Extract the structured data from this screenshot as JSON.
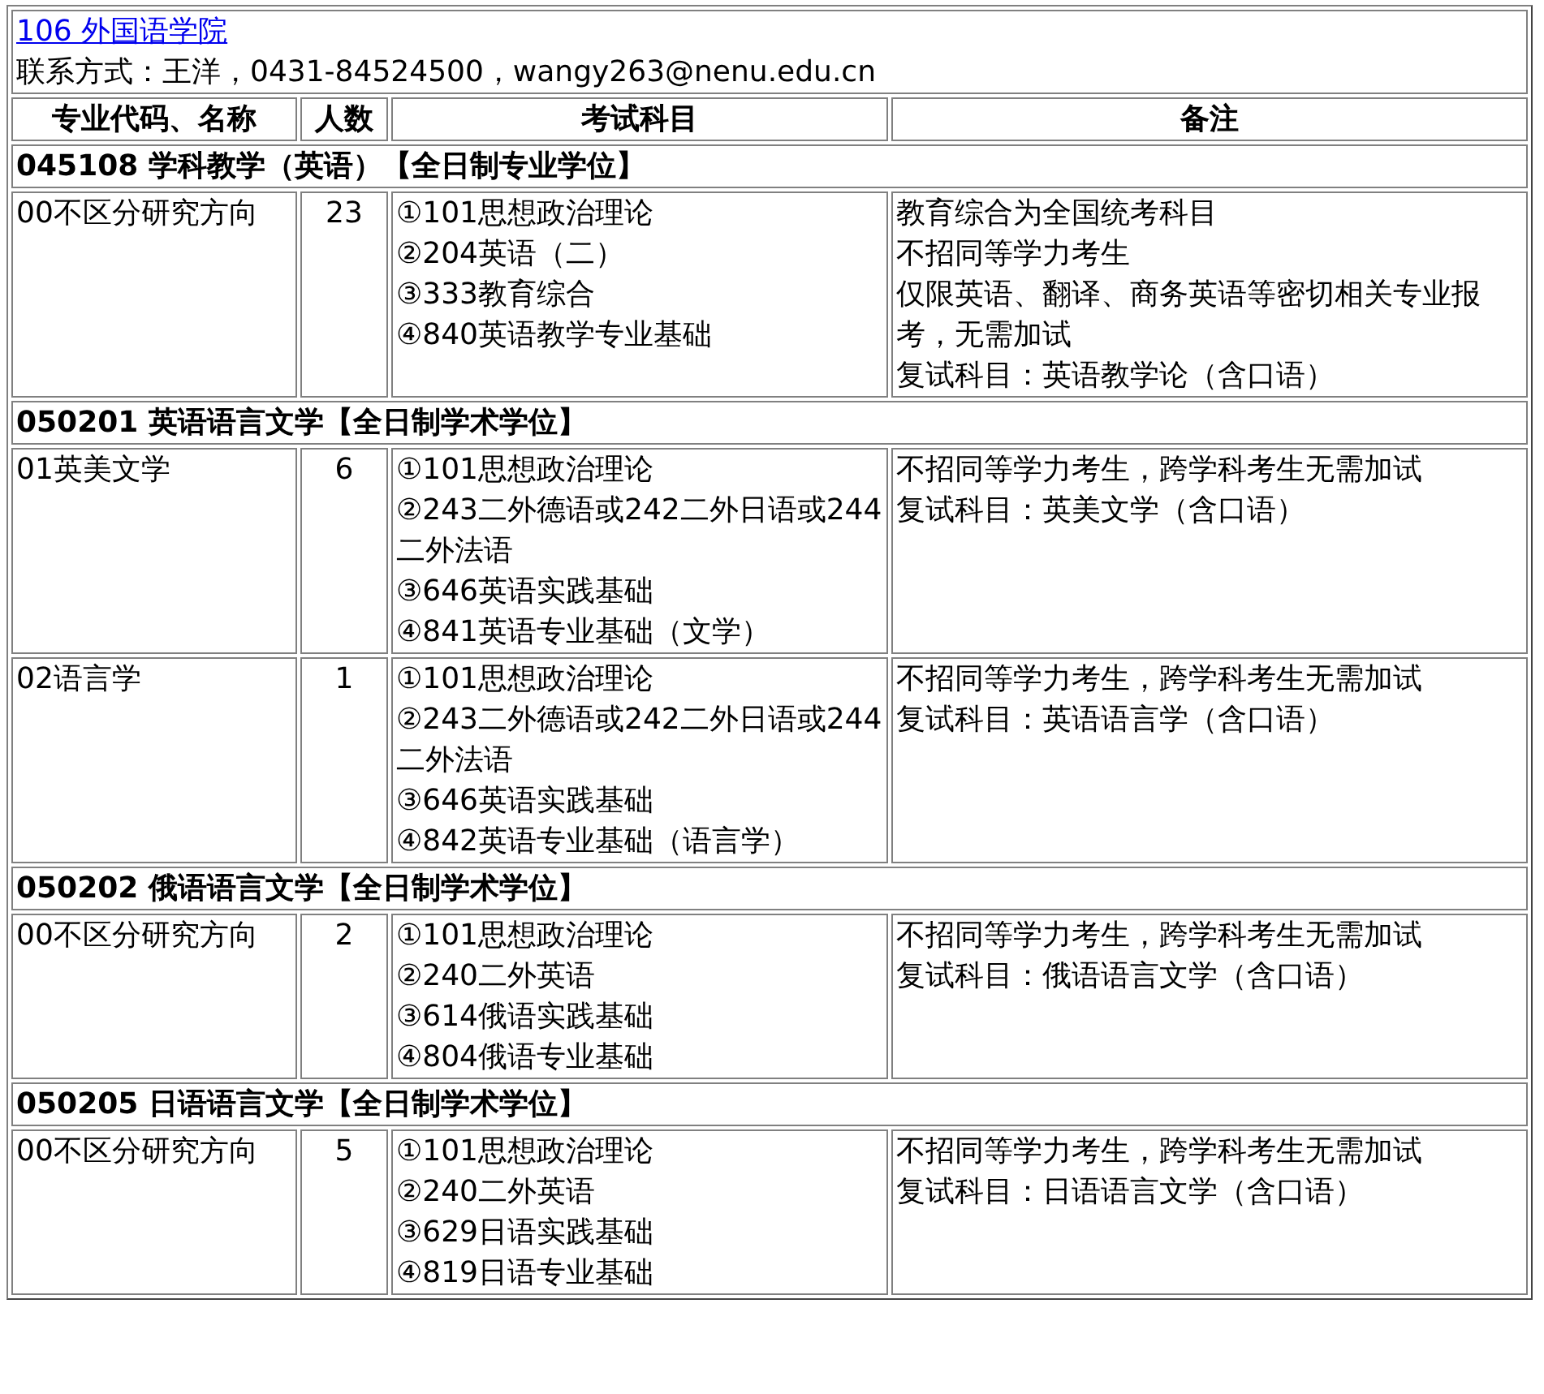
{
  "header": {
    "department_link": "106 外国语学院",
    "contact": "联系方式：王洋，0431-84524500，wangy263@nenu.edu.cn"
  },
  "columns": [
    "专业代码、名称",
    "人数",
    "考试科目",
    "备注"
  ],
  "programs": [
    {
      "title": "045108 学科教学（英语）【全日制专业学位】",
      "directions": [
        {
          "name": "00不区分研究方向",
          "count": "23",
          "subjects": [
            "①101思想政治理论",
            "②204英语（二）",
            "③333教育综合",
            "④840英语教学专业基础"
          ],
          "notes": [
            "教育综合为全国统考科目",
            "不招同等学力考生",
            "仅限英语、翻译、商务英语等密切相关专业报考，无需加试",
            "复试科目：英语教学论（含口语）"
          ]
        }
      ]
    },
    {
      "title": "050201 英语语言文学【全日制学术学位】",
      "directions": [
        {
          "name": "01英美文学",
          "count": "6",
          "subjects": [
            "①101思想政治理论",
            "②243二外德语或242二外日语或244二外法语",
            "③646英语实践基础",
            "④841英语专业基础（文学）"
          ],
          "notes": [
            "不招同等学力考生，跨学科考生无需加试",
            "复试科目：英美文学（含口语）"
          ]
        },
        {
          "name": "02语言学",
          "count": "1",
          "subjects": [
            "①101思想政治理论",
            "②243二外德语或242二外日语或244二外法语",
            "③646英语实践基础",
            "④842英语专业基础（语言学）"
          ],
          "notes": [
            "不招同等学力考生，跨学科考生无需加试",
            "复试科目：英语语言学（含口语）"
          ]
        }
      ]
    },
    {
      "title": "050202 俄语语言文学【全日制学术学位】",
      "directions": [
        {
          "name": "00不区分研究方向",
          "count": "2",
          "subjects": [
            "①101思想政治理论",
            "②240二外英语",
            "③614俄语实践基础",
            "④804俄语专业基础"
          ],
          "notes": [
            "不招同等学力考生，跨学科考生无需加试",
            "复试科目：俄语语言文学（含口语）"
          ]
        }
      ]
    },
    {
      "title": "050205 日语语言文学【全日制学术学位】",
      "directions": [
        {
          "name": "00不区分研究方向",
          "count": "5",
          "subjects": [
            "①101思想政治理论",
            "②240二外英语",
            "③629日语实践基础",
            "④819日语专业基础"
          ],
          "notes": [
            "不招同等学力考生，跨学科考生无需加试",
            "复试科目：日语语言文学（含口语）"
          ]
        }
      ]
    }
  ]
}
